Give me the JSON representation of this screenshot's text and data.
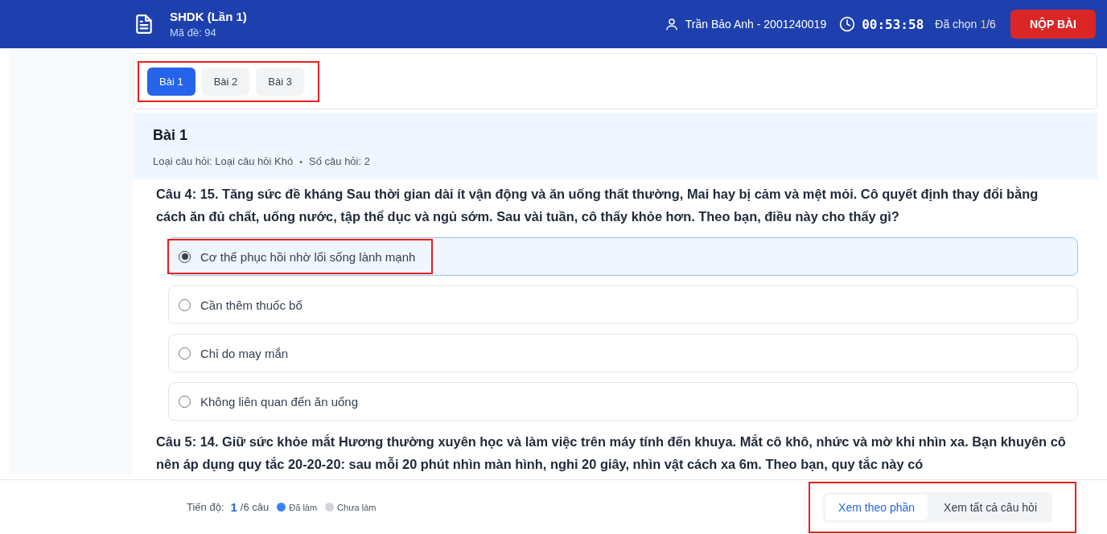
{
  "header": {
    "title": "SHDK (Lần 1)",
    "subtitle": "Mã đề: 94",
    "student": "Trần Bảo Anh - 2001240019",
    "timer": "00:53:58",
    "chosen_label": "Đã chọn",
    "chosen_count": "1",
    "chosen_total": "/6",
    "submit": "NỘP BÀI"
  },
  "tabs": {
    "highlighted": true,
    "items": [
      {
        "label": "Bài 1",
        "selected": true
      },
      {
        "label": "Bài 2",
        "selected": false
      },
      {
        "label": "Bài 3",
        "selected": false
      }
    ]
  },
  "section": {
    "title": "Bài 1",
    "type": "Loại câu hỏi: Loại câu hỏi Khó",
    "separator": "•",
    "count": "Số câu hỏi: 2"
  },
  "questions": [
    {
      "text": "Câu 4: 15. Tăng sức đề kháng Sau thời gian dài ít vận động và ăn uống thất thường, Mai hay bị cảm và mệt mỏi. Cô quyết định thay đổi bằng cách ăn đủ chất, uống nước, tập thể dục và ngủ sớm. Sau vài tuần, cô thấy khỏe hơn. Theo bạn, điều này cho thấy gì?",
      "options": [
        {
          "label": "Cơ thể phục hồi nhờ lối sống lành mạnh",
          "selected": true,
          "highlighted": true
        },
        {
          "label": "Cần thêm thuốc bổ",
          "selected": false,
          "highlighted": false
        },
        {
          "label": "Chỉ do may mắn",
          "selected": false,
          "highlighted": false
        },
        {
          "label": "Không liên quan đến ăn uống",
          "selected": false,
          "highlighted": false
        }
      ]
    },
    {
      "text": "Câu 5: 14. Giữ sức khỏe mắt Hương thường xuyên học và làm việc trên máy tính đến khuya. Mắt cô khô, nhức và mờ khi nhìn xa. Bạn khuyên cô nên áp dụng quy tắc 20-20-20: sau mỗi 20 phút nhìn màn hình, nghỉ 20 giây, nhìn vật cách xa 6m. Theo bạn, quy tắc này có"
    }
  ],
  "footer": {
    "progress_label": "Tiến độ:",
    "progress_done": "1",
    "progress_total": "/6 câu",
    "legend": [
      {
        "label": "Đã làm",
        "color": "#3b82f6"
      },
      {
        "label": "Chưa làm",
        "color": "#d1d5db"
      }
    ],
    "view_highlighted": true,
    "views": [
      {
        "label": "Xem theo phần",
        "selected": true
      },
      {
        "label": "Xem tất cả câu hỏi",
        "selected": false
      }
    ]
  }
}
